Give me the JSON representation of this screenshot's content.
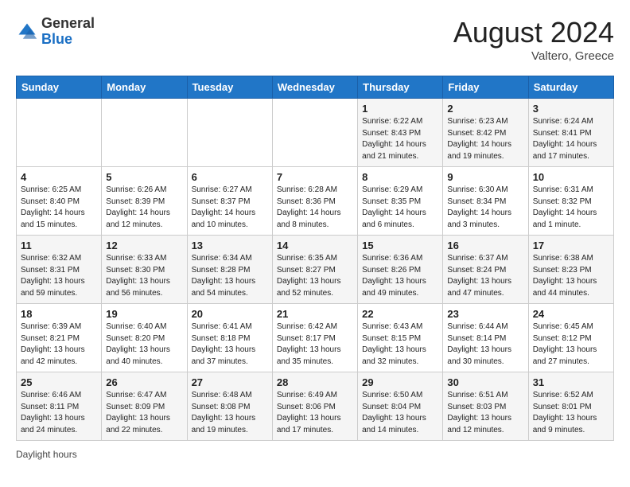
{
  "header": {
    "logo": {
      "general": "General",
      "blue": "Blue"
    },
    "title": "August 2024",
    "location": "Valtero, Greece"
  },
  "calendar": {
    "days_of_week": [
      "Sunday",
      "Monday",
      "Tuesday",
      "Wednesday",
      "Thursday",
      "Friday",
      "Saturday"
    ],
    "weeks": [
      [
        {
          "day": "",
          "info": ""
        },
        {
          "day": "",
          "info": ""
        },
        {
          "day": "",
          "info": ""
        },
        {
          "day": "",
          "info": ""
        },
        {
          "day": "1",
          "info": "Sunrise: 6:22 AM\nSunset: 8:43 PM\nDaylight: 14 hours and 21 minutes."
        },
        {
          "day": "2",
          "info": "Sunrise: 6:23 AM\nSunset: 8:42 PM\nDaylight: 14 hours and 19 minutes."
        },
        {
          "day": "3",
          "info": "Sunrise: 6:24 AM\nSunset: 8:41 PM\nDaylight: 14 hours and 17 minutes."
        }
      ],
      [
        {
          "day": "4",
          "info": "Sunrise: 6:25 AM\nSunset: 8:40 PM\nDaylight: 14 hours and 15 minutes."
        },
        {
          "day": "5",
          "info": "Sunrise: 6:26 AM\nSunset: 8:39 PM\nDaylight: 14 hours and 12 minutes."
        },
        {
          "day": "6",
          "info": "Sunrise: 6:27 AM\nSunset: 8:37 PM\nDaylight: 14 hours and 10 minutes."
        },
        {
          "day": "7",
          "info": "Sunrise: 6:28 AM\nSunset: 8:36 PM\nDaylight: 14 hours and 8 minutes."
        },
        {
          "day": "8",
          "info": "Sunrise: 6:29 AM\nSunset: 8:35 PM\nDaylight: 14 hours and 6 minutes."
        },
        {
          "day": "9",
          "info": "Sunrise: 6:30 AM\nSunset: 8:34 PM\nDaylight: 14 hours and 3 minutes."
        },
        {
          "day": "10",
          "info": "Sunrise: 6:31 AM\nSunset: 8:32 PM\nDaylight: 14 hours and 1 minute."
        }
      ],
      [
        {
          "day": "11",
          "info": "Sunrise: 6:32 AM\nSunset: 8:31 PM\nDaylight: 13 hours and 59 minutes."
        },
        {
          "day": "12",
          "info": "Sunrise: 6:33 AM\nSunset: 8:30 PM\nDaylight: 13 hours and 56 minutes."
        },
        {
          "day": "13",
          "info": "Sunrise: 6:34 AM\nSunset: 8:28 PM\nDaylight: 13 hours and 54 minutes."
        },
        {
          "day": "14",
          "info": "Sunrise: 6:35 AM\nSunset: 8:27 PM\nDaylight: 13 hours and 52 minutes."
        },
        {
          "day": "15",
          "info": "Sunrise: 6:36 AM\nSunset: 8:26 PM\nDaylight: 13 hours and 49 minutes."
        },
        {
          "day": "16",
          "info": "Sunrise: 6:37 AM\nSunset: 8:24 PM\nDaylight: 13 hours and 47 minutes."
        },
        {
          "day": "17",
          "info": "Sunrise: 6:38 AM\nSunset: 8:23 PM\nDaylight: 13 hours and 44 minutes."
        }
      ],
      [
        {
          "day": "18",
          "info": "Sunrise: 6:39 AM\nSunset: 8:21 PM\nDaylight: 13 hours and 42 minutes."
        },
        {
          "day": "19",
          "info": "Sunrise: 6:40 AM\nSunset: 8:20 PM\nDaylight: 13 hours and 40 minutes."
        },
        {
          "day": "20",
          "info": "Sunrise: 6:41 AM\nSunset: 8:18 PM\nDaylight: 13 hours and 37 minutes."
        },
        {
          "day": "21",
          "info": "Sunrise: 6:42 AM\nSunset: 8:17 PM\nDaylight: 13 hours and 35 minutes."
        },
        {
          "day": "22",
          "info": "Sunrise: 6:43 AM\nSunset: 8:15 PM\nDaylight: 13 hours and 32 minutes."
        },
        {
          "day": "23",
          "info": "Sunrise: 6:44 AM\nSunset: 8:14 PM\nDaylight: 13 hours and 30 minutes."
        },
        {
          "day": "24",
          "info": "Sunrise: 6:45 AM\nSunset: 8:12 PM\nDaylight: 13 hours and 27 minutes."
        }
      ],
      [
        {
          "day": "25",
          "info": "Sunrise: 6:46 AM\nSunset: 8:11 PM\nDaylight: 13 hours and 24 minutes."
        },
        {
          "day": "26",
          "info": "Sunrise: 6:47 AM\nSunset: 8:09 PM\nDaylight: 13 hours and 22 minutes."
        },
        {
          "day": "27",
          "info": "Sunrise: 6:48 AM\nSunset: 8:08 PM\nDaylight: 13 hours and 19 minutes."
        },
        {
          "day": "28",
          "info": "Sunrise: 6:49 AM\nSunset: 8:06 PM\nDaylight: 13 hours and 17 minutes."
        },
        {
          "day": "29",
          "info": "Sunrise: 6:50 AM\nSunset: 8:04 PM\nDaylight: 13 hours and 14 minutes."
        },
        {
          "day": "30",
          "info": "Sunrise: 6:51 AM\nSunset: 8:03 PM\nDaylight: 13 hours and 12 minutes."
        },
        {
          "day": "31",
          "info": "Sunrise: 6:52 AM\nSunset: 8:01 PM\nDaylight: 13 hours and 9 minutes."
        }
      ]
    ]
  },
  "footer": {
    "daylight_hours_label": "Daylight hours"
  }
}
